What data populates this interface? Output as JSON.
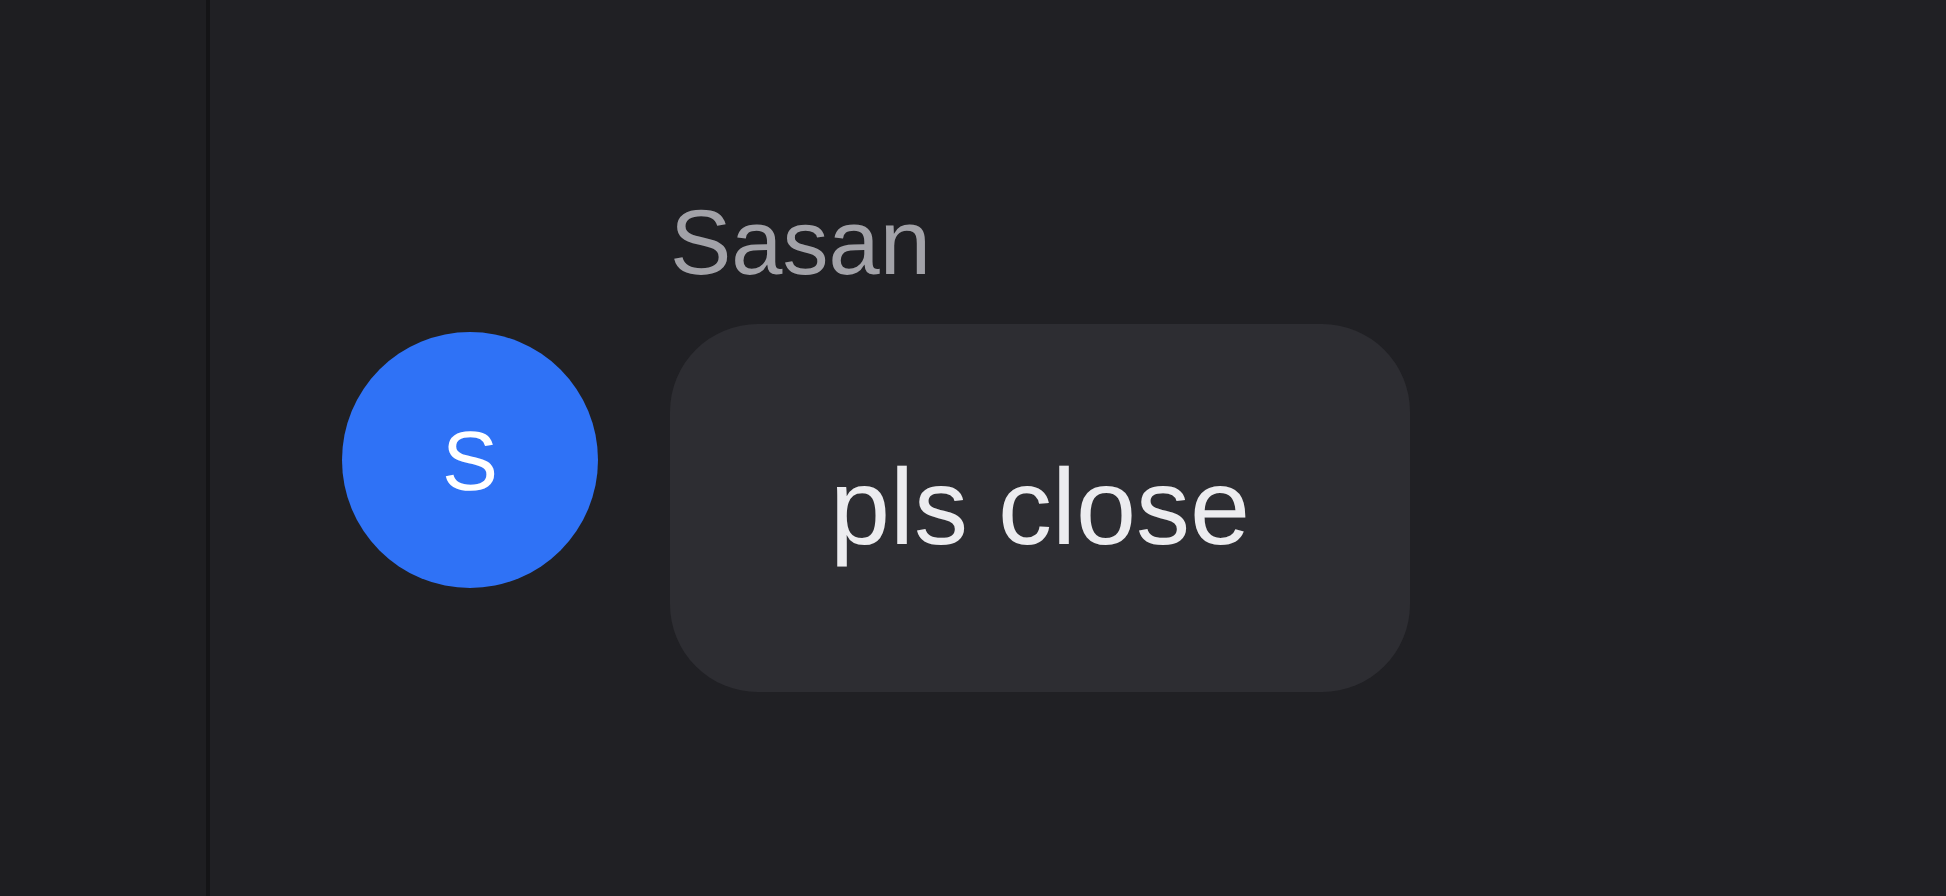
{
  "messages": [
    {
      "sender": "Sasan",
      "avatar_initial": "S",
      "color": "#2f72f6",
      "text": "pls close"
    }
  ]
}
